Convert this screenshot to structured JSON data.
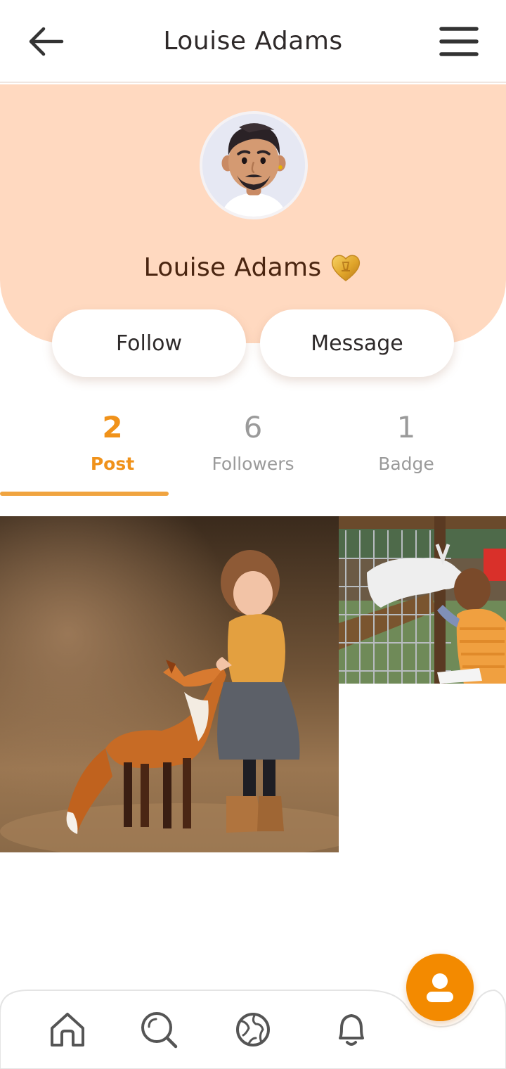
{
  "header": {
    "title": "Louise Adams",
    "back_icon": "arrow-left-icon",
    "menu_icon": "hamburger-menu-icon"
  },
  "profile": {
    "name": "Louise Adams",
    "badge_icon": "gold-heart-badge-icon",
    "avatar": "3d-avatar-man-with-beard",
    "follow_label": "Follow",
    "message_label": "Message"
  },
  "stats": [
    {
      "count": "2",
      "label": "Post",
      "active": true
    },
    {
      "count": "6",
      "label": "Followers",
      "active": false
    },
    {
      "count": "1",
      "label": "Badge",
      "active": false
    }
  ],
  "posts": [
    {
      "image": "girl-with-fox-photo"
    },
    {
      "image": "child-feeding-goat-photo"
    }
  ],
  "nav": {
    "items": [
      "home-icon",
      "search-icon",
      "globe-icon",
      "bell-icon"
    ],
    "fab_icon": "user-icon"
  },
  "colors": {
    "accent": "#f38a00",
    "accent_text": "#f0921a",
    "header_bg": "#ffd9c0",
    "inactive_text": "#9a9a9a"
  }
}
